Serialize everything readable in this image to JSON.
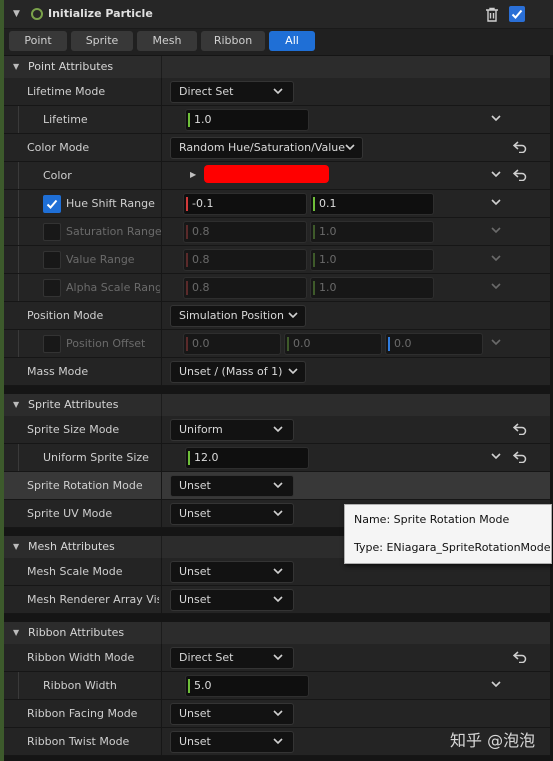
{
  "module": {
    "title": "Initialize Particle",
    "enabled": true
  },
  "tabs": [
    {
      "label": "Point"
    },
    {
      "label": "Sprite"
    },
    {
      "label": "Mesh"
    },
    {
      "label": "Ribbon"
    },
    {
      "label": "All",
      "active": true
    }
  ],
  "point_attributes": {
    "title": "Point Attributes",
    "lifetime_mode": {
      "label": "Lifetime Mode",
      "value": "Direct Set"
    },
    "lifetime": {
      "label": "Lifetime",
      "value": "1.0"
    },
    "color_mode": {
      "label": "Color Mode",
      "value": "Random Hue/Saturation/Value"
    },
    "color": {
      "label": "Color",
      "swatch": "#ff0000"
    },
    "hue_shift_range": {
      "label": "Hue Shift Range",
      "checked": true,
      "min": "-0.1",
      "max": "0.1"
    },
    "saturation_range": {
      "label": "Saturation Range",
      "checked": false,
      "min": "0.8",
      "max": "1.0"
    },
    "value_range": {
      "label": "Value Range",
      "checked": false,
      "min": "0.8",
      "max": "1.0"
    },
    "alpha_scale_range": {
      "label": "Alpha Scale Range",
      "checked": false,
      "min": "0.8",
      "max": "1.0"
    },
    "position_mode": {
      "label": "Position Mode",
      "value": "Simulation Position"
    },
    "position_offset": {
      "label": "Position Offset",
      "checked": false,
      "x": "0.0",
      "y": "0.0",
      "z": "0.0"
    },
    "mass_mode": {
      "label": "Mass Mode",
      "value": "Unset / (Mass of 1)"
    }
  },
  "sprite_attributes": {
    "title": "Sprite Attributes",
    "sprite_size_mode": {
      "label": "Sprite Size Mode",
      "value": "Uniform"
    },
    "uniform_sprite_size": {
      "label": "Uniform Sprite Size",
      "value": "12.0"
    },
    "sprite_rotation_mode": {
      "label": "Sprite Rotation Mode",
      "value": "Unset"
    },
    "sprite_uv_mode": {
      "label": "Sprite UV Mode",
      "value": "Unset"
    }
  },
  "mesh_attributes": {
    "title": "Mesh Attributes",
    "mesh_scale_mode": {
      "label": "Mesh Scale Mode",
      "value": "Unset"
    },
    "mesh_renderer_array_visibility": {
      "label": "Mesh Renderer Array Visil",
      "value": "Unset"
    }
  },
  "ribbon_attributes": {
    "title": "Ribbon Attributes",
    "ribbon_width_mode": {
      "label": "Ribbon Width Mode",
      "value": "Direct Set"
    },
    "ribbon_width": {
      "label": "Ribbon Width",
      "value": "5.0"
    },
    "ribbon_facing_mode": {
      "label": "Ribbon Facing Mode",
      "value": "Unset"
    },
    "ribbon_twist_mode": {
      "label": "Ribbon Twist Mode",
      "value": "Unset"
    }
  },
  "tooltip": {
    "name_line": "Name: Sprite Rotation Mode",
    "type_line": "Type: ENiagara_SpriteRotationMode"
  },
  "watermark": "知乎 @泡泡",
  "colors": {
    "accent": "#1f6fd6",
    "x_axis": "#d23a3a",
    "y_axis": "#6fbf3a",
    "z_axis": "#2f7de0",
    "module_bar": "#3d5a2c"
  }
}
